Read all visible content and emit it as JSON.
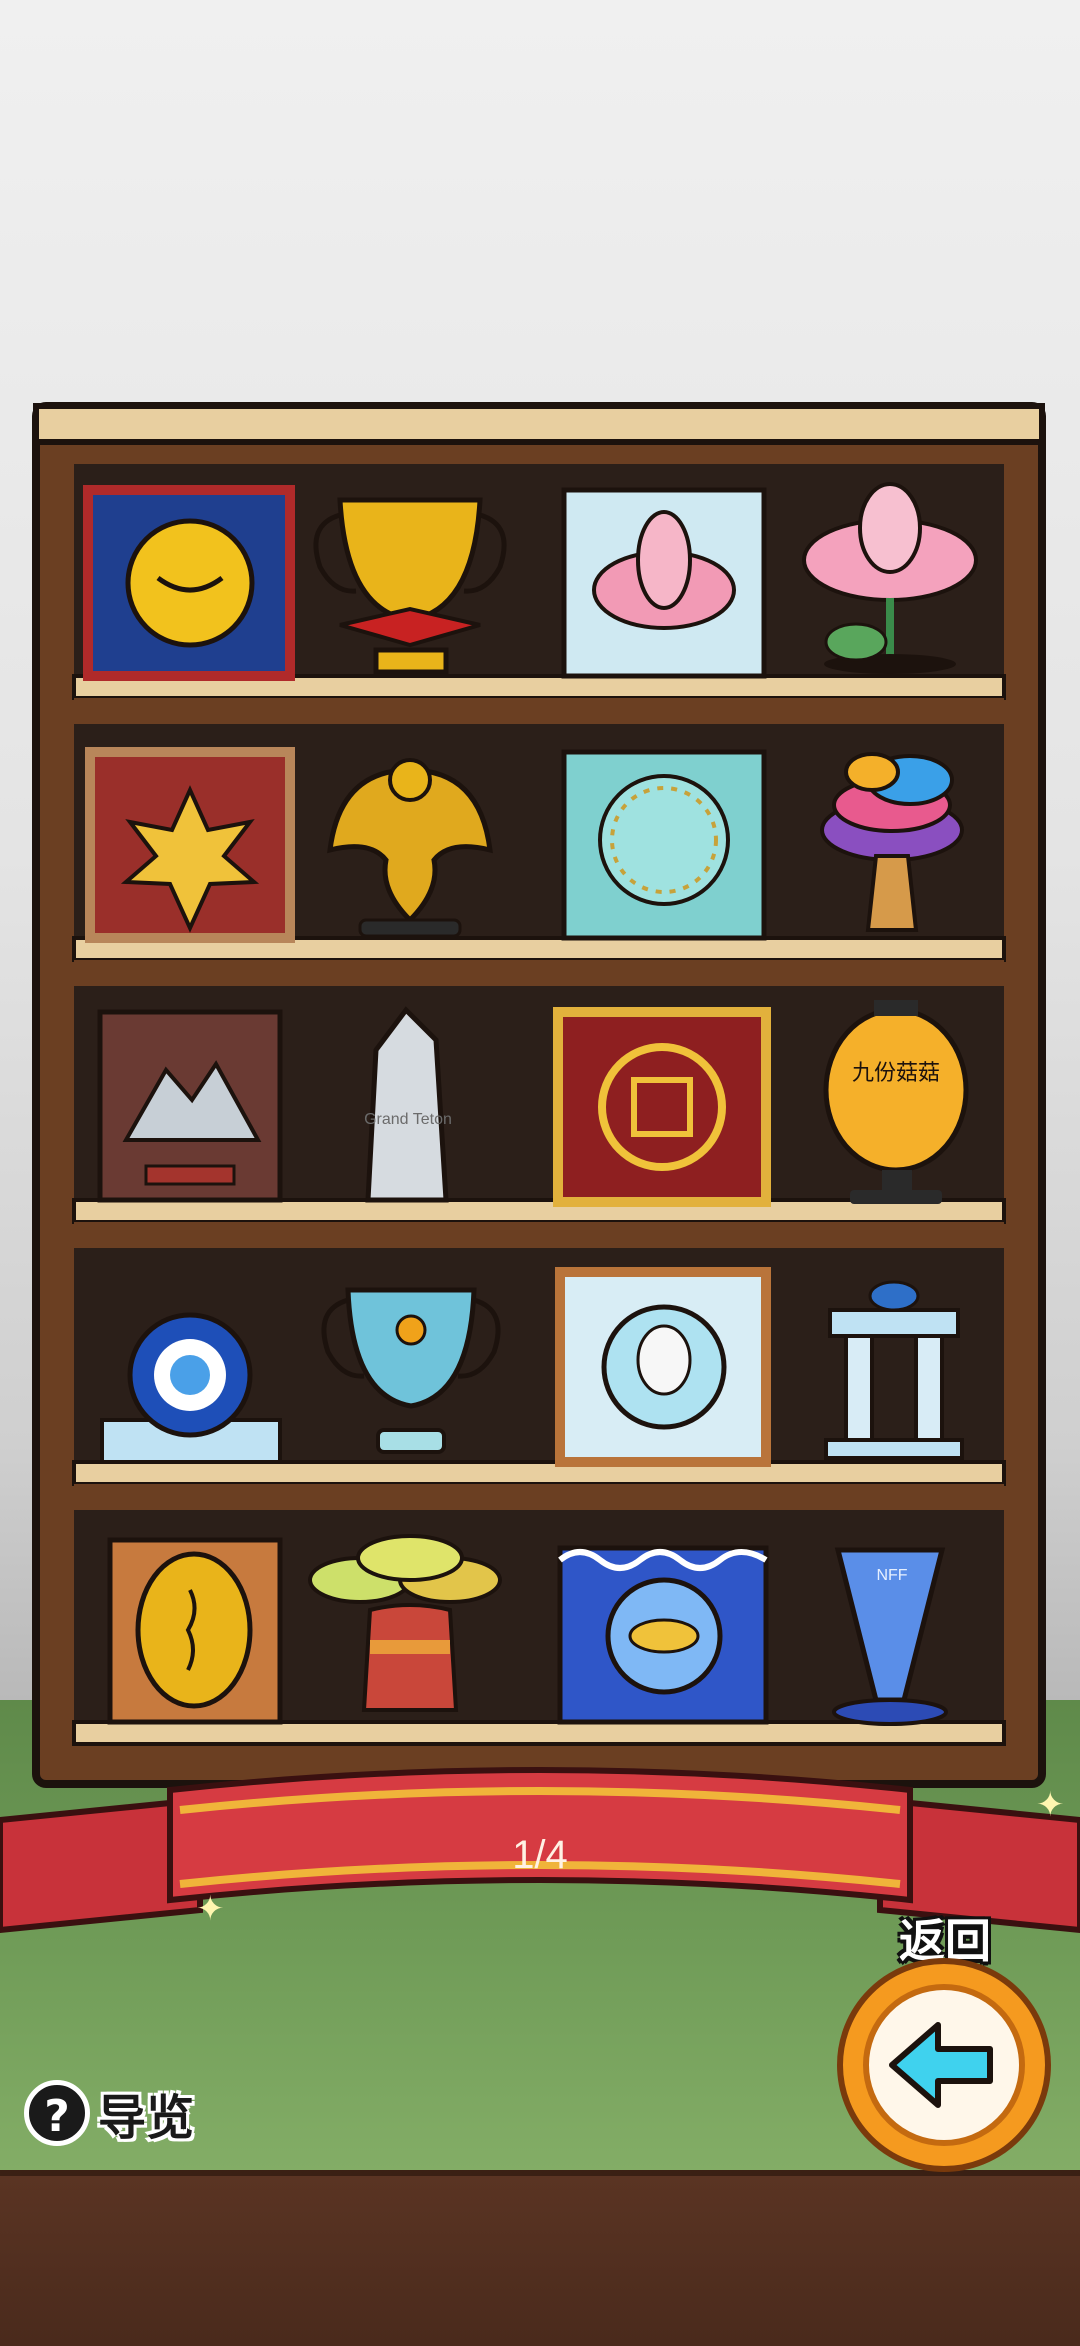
{
  "pagination": {
    "current": "1/4"
  },
  "back_button": {
    "label": "返回",
    "icon": "arrow-left-icon"
  },
  "guide_button": {
    "icon": "question-mark-icon",
    "icon_glyph": "?",
    "label": "导览"
  },
  "shelf": {
    "rows": [
      {
        "items": [
          {
            "name": "smile-medal-plaque-icon"
          },
          {
            "name": "golden-trophy-cup-icon"
          },
          {
            "name": "lotus-tile-icon"
          },
          {
            "name": "lotus-statue-icon"
          }
        ]
      },
      {
        "items": [
          {
            "name": "maple-leaf-plaque-icon"
          },
          {
            "name": "golden-eagle-statue-icon"
          },
          {
            "name": "coral-ring-tile-icon"
          },
          {
            "name": "coral-tree-icon"
          }
        ]
      },
      {
        "items": [
          {
            "name": "mountain-plaque-icon"
          },
          {
            "name": "grand-teton-crystal-icon",
            "text": "Grand Teton"
          },
          {
            "name": "double-happiness-plaque-icon"
          },
          {
            "name": "lantern-icon",
            "text": "九份菇菇"
          }
        ]
      },
      {
        "items": [
          {
            "name": "evil-eye-icon"
          },
          {
            "name": "crystal-trophy-cup-icon"
          },
          {
            "name": "mushroom-medal-frame-icon"
          },
          {
            "name": "temple-gate-icon"
          }
        ]
      },
      {
        "items": [
          {
            "name": "island-medal-plaque-icon"
          },
          {
            "name": "baobab-tree-icon"
          },
          {
            "name": "submarine-tile-icon"
          },
          {
            "name": "blue-glass-trophy-icon",
            "text": "NFF"
          }
        ]
      }
    ]
  },
  "colors": {
    "wood_dark": "#6b3f22",
    "wood_light": "#e8cfa0",
    "shelf_inner": "#2b1f19",
    "ribbon_red": "#c8323a",
    "ribbon_gold": "#f0b43a",
    "back_button_orange": "#f59a1f",
    "arrow_cyan": "#3fd2ee"
  }
}
